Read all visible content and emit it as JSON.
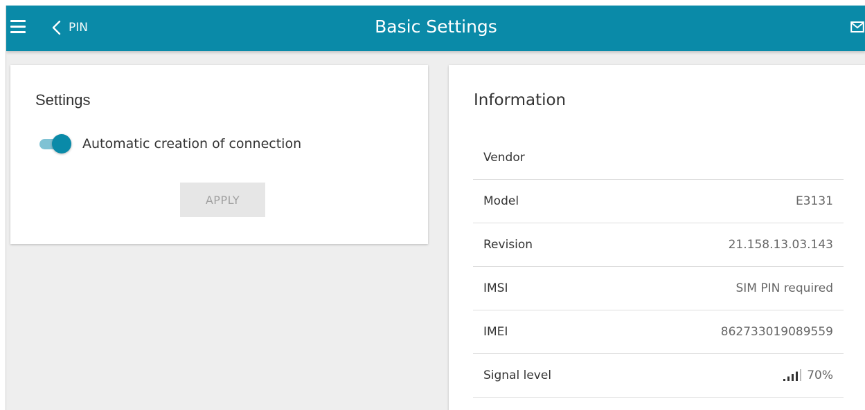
{
  "header": {
    "back_label": "PIN",
    "title": "Basic Settings",
    "menu_icon": "hamburger-icon",
    "back_icon": "chevron-left-icon",
    "mail_icon": "mail-icon"
  },
  "settings": {
    "title": "Settings",
    "toggle_label": "Automatic creation of connection",
    "toggle_on": true,
    "apply_label": "APPLY"
  },
  "information": {
    "title": "Information",
    "rows": [
      {
        "label": "Vendor",
        "value": ""
      },
      {
        "label": "Model",
        "value": "E3131"
      },
      {
        "label": "Revision",
        "value": "21.158.13.03.143"
      },
      {
        "label": "IMSI",
        "value": "SIM PIN required"
      },
      {
        "label": "IMEI",
        "value": "862733019089559"
      },
      {
        "label": "Signal level",
        "value": "70%"
      }
    ],
    "signal_percent": 70
  },
  "colors": {
    "accent": "#0a8aa8",
    "background": "#eeeeee"
  }
}
